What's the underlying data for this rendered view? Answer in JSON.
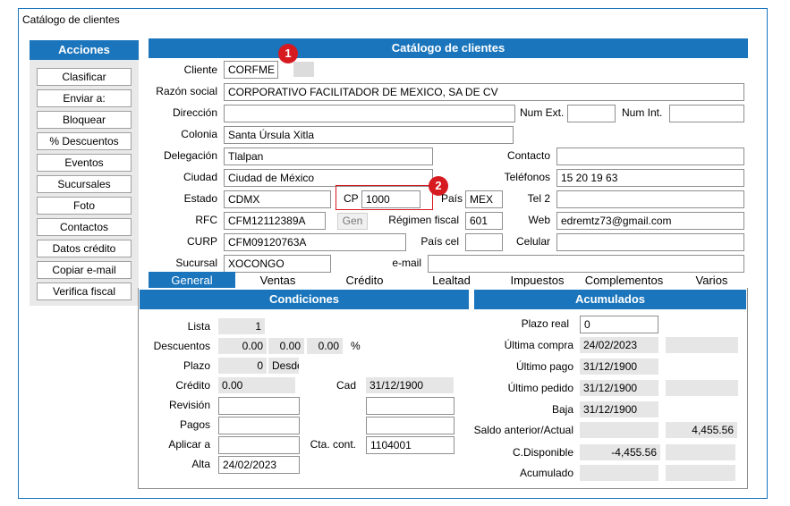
{
  "window": {
    "title": "Catálogo de clientes"
  },
  "actions": {
    "header": "Acciones",
    "buttons": [
      "Clasificar",
      "Enviar a:",
      "Bloquear",
      "% Descuentos",
      "Eventos",
      "Sucursales",
      "Foto",
      "Contactos",
      "Datos crédito",
      "Copiar e-mail",
      "Verifica fiscal"
    ]
  },
  "main": {
    "header": "Catálogo de clientes",
    "badge1": "1",
    "badge2": "2",
    "labels": {
      "cliente": "Cliente",
      "razon": "Razón social",
      "direccion": "Dirección",
      "num_ext": "Num Ext.",
      "num_int": "Num Int.",
      "colonia": "Colonia",
      "delegacion": "Delegación",
      "contacto": "Contacto",
      "ciudad": "Ciudad",
      "telefonos": "Teléfonos",
      "estado": "Estado",
      "cp": "CP",
      "pais": "País",
      "tel2": "Tel 2",
      "rfc": "RFC",
      "regimen": "Régimen fiscal",
      "web": "Web",
      "gen": "Gen",
      "curp": "CURP",
      "pais_cel": "País cel",
      "celular": "Celular",
      "sucursal": "Sucursal",
      "email": "e-mail"
    },
    "values": {
      "cliente": "CORFME",
      "razon": "CORPORATIVO FACILITADOR DE MEXICO, SA DE CV",
      "direccion": "",
      "num_ext": "",
      "num_int": "",
      "colonia": "Santa Úrsula Xitla",
      "delegacion": "Tlalpan",
      "contacto": "",
      "ciudad": "Ciudad de México",
      "telefonos": "15 20 19 63",
      "estado": "CDMX",
      "cp": "1000",
      "pais": "MEX",
      "tel2": "",
      "rfc": "CFM12112389A",
      "regimen": "601",
      "web": "edremtz73@gmail.com",
      "curp": "CFM09120763A",
      "pais_cel": "",
      "celular": "",
      "sucursal": "XOCONGO",
      "email": ""
    }
  },
  "tabs": [
    "General",
    "Ventas",
    "Crédito",
    "Lealtad",
    "Impuestos",
    "Complementos",
    "Varios"
  ],
  "condiciones": {
    "header": "Condiciones",
    "labels": {
      "lista": "Lista",
      "descuentos": "Descuentos",
      "pct": "%",
      "plazo": "Plazo",
      "desde": "Desde",
      "credito": "Crédito",
      "cad": "Cad",
      "revision": "Revisión",
      "pagos": "Pagos",
      "aplicar": "Aplicar a",
      "cta": "Cta. cont.",
      "alta": "Alta"
    },
    "values": {
      "lista": "1",
      "desc1": "0.00",
      "desc2": "0.00",
      "desc3": "0.00",
      "plazo": "0",
      "credito": "0.00",
      "cad": "31/12/1900",
      "revision": "",
      "pagos": "",
      "aplicar": "",
      "cta": "1104001",
      "alta": "24/02/2023"
    }
  },
  "acumulados": {
    "header": "Acumulados",
    "labels": {
      "plazo_real": "Plazo real",
      "ultima_compra": "Última compra",
      "ultimo_pago": "Último pago",
      "ultimo_pedido": "Último pedido",
      "baja": "Baja",
      "saldo": "Saldo anterior/Actual",
      "disponible": "C.Disponible",
      "acumulado": "Acumulado"
    },
    "values": {
      "plazo_real": "0",
      "ultima_compra": "24/02/2023",
      "ultimo_pago": "31/12/1900",
      "ultimo_pedido": "31/12/1900",
      "baja": "31/12/1900",
      "saldo_actual": "4,455.56",
      "disponible": "-4,455.56"
    }
  }
}
